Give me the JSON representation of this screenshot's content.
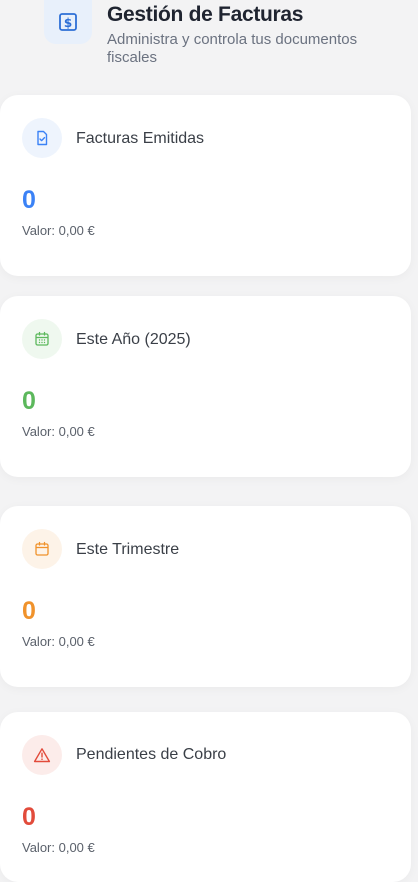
{
  "header": {
    "title": "Gestión de Facturas",
    "subtitle": "Administra y controla tus documentos fiscales",
    "icon": "dollar-document-icon"
  },
  "cards": [
    {
      "label": "Facturas Emitidas",
      "value": "0",
      "valor": "Valor: 0,00 €",
      "icon": "document-check-icon",
      "color": "#3b82f6",
      "icon_bg": "#eef4fd"
    },
    {
      "label": "Este Año (2025)",
      "value": "0",
      "valor": "Valor: 0,00 €",
      "icon": "calendar-grid-icon",
      "color": "#5cb85c",
      "icon_bg": "#eff8ef"
    },
    {
      "label": "Este Trimestre",
      "value": "0",
      "valor": "Valor: 0,00 €",
      "icon": "calendar-icon",
      "color": "#f0922b",
      "icon_bg": "#fdf3e8"
    },
    {
      "label": "Pendientes de Cobro",
      "value": "0",
      "valor": "Valor: 0,00 €",
      "icon": "warning-icon",
      "color": "#e24b3b",
      "icon_bg": "#fcecea"
    }
  ]
}
